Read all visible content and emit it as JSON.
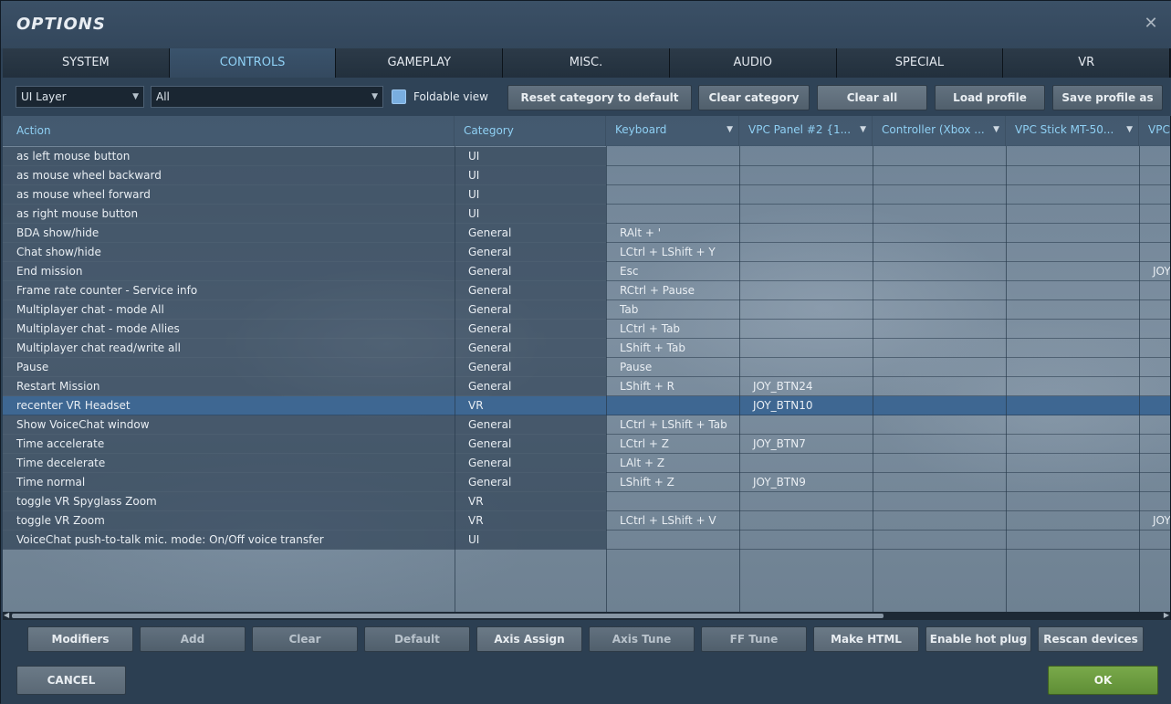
{
  "window": {
    "title": "OPTIONS",
    "close_icon": "close-icon"
  },
  "tabs": [
    {
      "label": "SYSTEM"
    },
    {
      "label": "CONTROLS"
    },
    {
      "label": "GAMEPLAY"
    },
    {
      "label": "MISC."
    },
    {
      "label": "AUDIO"
    },
    {
      "label": "SPECIAL"
    },
    {
      "label": "VR"
    }
  ],
  "active_tab": "CONTROLS",
  "filters": {
    "layer": "UI Layer",
    "category": "All",
    "foldable_view_label": "Foldable view",
    "foldable_view_checked": true
  },
  "toolbar": {
    "reset_category": "Reset category to default",
    "clear_category": "Clear category",
    "clear_all": "Clear all",
    "load_profile": "Load profile",
    "save_profile": "Save profile as"
  },
  "columns": [
    {
      "label": "Action"
    },
    {
      "label": "Category"
    },
    {
      "label": "Keyboard"
    },
    {
      "label": "VPC Panel #2 {1..."
    },
    {
      "label": "Controller (Xbox ..."
    },
    {
      "label": "VPC Stick MT-50..."
    },
    {
      "label": "VPC"
    }
  ],
  "rows": [
    {
      "action": "as left mouse button",
      "category": "UI",
      "keyboard": "",
      "vpc_panel": "",
      "controller": "",
      "vpc_stick": "",
      "vpc": ""
    },
    {
      "action": "as mouse wheel backward",
      "category": "UI",
      "keyboard": "",
      "vpc_panel": "",
      "controller": "",
      "vpc_stick": "",
      "vpc": ""
    },
    {
      "action": "as mouse wheel forward",
      "category": "UI",
      "keyboard": "",
      "vpc_panel": "",
      "controller": "",
      "vpc_stick": "",
      "vpc": ""
    },
    {
      "action": "as right mouse button",
      "category": "UI",
      "keyboard": "",
      "vpc_panel": "",
      "controller": "",
      "vpc_stick": "",
      "vpc": ""
    },
    {
      "action": "BDA show/hide",
      "category": "General",
      "keyboard": "RAlt + '",
      "vpc_panel": "",
      "controller": "",
      "vpc_stick": "",
      "vpc": ""
    },
    {
      "action": "Chat show/hide",
      "category": "General",
      "keyboard": "LCtrl + LShift + Y",
      "vpc_panel": "",
      "controller": "",
      "vpc_stick": "",
      "vpc": ""
    },
    {
      "action": "End mission",
      "category": "General",
      "keyboard": "Esc",
      "vpc_panel": "",
      "controller": "",
      "vpc_stick": "",
      "vpc": "JOY_"
    },
    {
      "action": "Frame rate counter - Service info",
      "category": "General",
      "keyboard": "RCtrl + Pause",
      "vpc_panel": "",
      "controller": "",
      "vpc_stick": "",
      "vpc": ""
    },
    {
      "action": "Multiplayer chat - mode All",
      "category": "General",
      "keyboard": "Tab",
      "vpc_panel": "",
      "controller": "",
      "vpc_stick": "",
      "vpc": ""
    },
    {
      "action": "Multiplayer chat - mode Allies",
      "category": "General",
      "keyboard": "LCtrl + Tab",
      "vpc_panel": "",
      "controller": "",
      "vpc_stick": "",
      "vpc": ""
    },
    {
      "action": "Multiplayer chat read/write all",
      "category": "General",
      "keyboard": "LShift + Tab",
      "vpc_panel": "",
      "controller": "",
      "vpc_stick": "",
      "vpc": ""
    },
    {
      "action": "Pause",
      "category": "General",
      "keyboard": "Pause",
      "vpc_panel": "",
      "controller": "",
      "vpc_stick": "",
      "vpc": ""
    },
    {
      "action": "Restart Mission",
      "category": "General",
      "keyboard": "LShift + R",
      "vpc_panel": "JOY_BTN24",
      "controller": "",
      "vpc_stick": "",
      "vpc": ""
    },
    {
      "action": "recenter VR Headset",
      "category": "VR",
      "keyboard": "",
      "vpc_panel": "JOY_BTN10",
      "controller": "",
      "vpc_stick": "",
      "vpc": "",
      "selected": true
    },
    {
      "action": "Show VoiceChat window",
      "category": "General",
      "keyboard": "LCtrl + LShift + Tab",
      "vpc_panel": "",
      "controller": "",
      "vpc_stick": "",
      "vpc": ""
    },
    {
      "action": "Time accelerate",
      "category": "General",
      "keyboard": "LCtrl + Z",
      "vpc_panel": "JOY_BTN7",
      "controller": "",
      "vpc_stick": "",
      "vpc": ""
    },
    {
      "action": "Time decelerate",
      "category": "General",
      "keyboard": "LAlt + Z",
      "vpc_panel": "",
      "controller": "",
      "vpc_stick": "",
      "vpc": ""
    },
    {
      "action": "Time normal",
      "category": "General",
      "keyboard": "LShift + Z",
      "vpc_panel": "JOY_BTN9",
      "controller": "",
      "vpc_stick": "",
      "vpc": ""
    },
    {
      "action": "toggle VR Spyglass Zoom",
      "category": "VR",
      "keyboard": "",
      "vpc_panel": "",
      "controller": "",
      "vpc_stick": "",
      "vpc": ""
    },
    {
      "action": "toggle VR Zoom",
      "category": "VR",
      "keyboard": "LCtrl + LShift + V",
      "vpc_panel": "",
      "controller": "",
      "vpc_stick": "",
      "vpc": "JOY_"
    },
    {
      "action": "VoiceChat push-to-talk mic. mode: On/Off voice transfer",
      "category": "UI",
      "keyboard": "",
      "vpc_panel": "",
      "controller": "",
      "vpc_stick": "",
      "vpc": ""
    }
  ],
  "bottom_buttons": {
    "modifiers": "Modifiers",
    "add": "Add",
    "clear": "Clear",
    "default": "Default",
    "axis_assign": "Axis Assign",
    "axis_tune": "Axis Tune",
    "ff_tune": "FF Tune",
    "make_html": "Make HTML",
    "enable_hot_plug": "Enable hot plug",
    "rescan_devices": "Rescan devices"
  },
  "footer": {
    "cancel": "CANCEL",
    "ok": "OK"
  },
  "colors": {
    "accent_text": "#8fd0f4",
    "selected_row": "#3e6792",
    "ok_button": "#6f9e42"
  }
}
